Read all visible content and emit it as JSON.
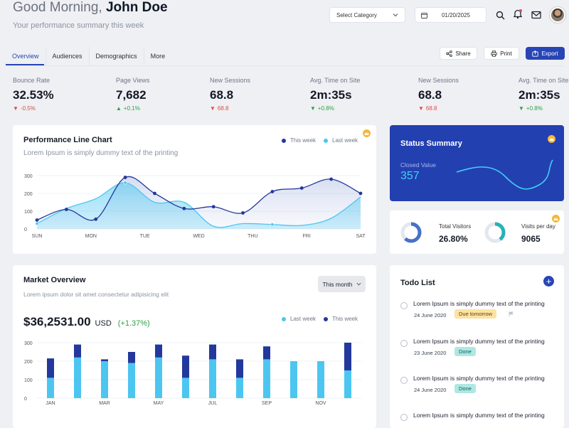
{
  "header": {
    "greeting_prefix": "Good Morning,",
    "user_name": "John Doe",
    "subtitle": "Your performance summary this week",
    "category_select": "Select Category",
    "date": "01/20/2025"
  },
  "tabs": [
    "Overview",
    "Audiences",
    "Demographics",
    "More"
  ],
  "actions": {
    "share": "Share",
    "print": "Print",
    "export": "Export"
  },
  "kpis": [
    {
      "label": "Bounce Rate",
      "value": "32.53%",
      "change": "-0.5%",
      "dir": "down"
    },
    {
      "label": "Page Views",
      "value": "7,682",
      "change": "+0.1%",
      "dir": "up"
    },
    {
      "label": "New Sessions",
      "value": "68.8",
      "change": "68.8",
      "dir": "down"
    },
    {
      "label": "Avg. Time on Site",
      "value": "2m:35s",
      "change": "+0.8%",
      "dir": "up"
    },
    {
      "label": "New Sessions",
      "value": "68.8",
      "change": "68.8",
      "dir": "down"
    },
    {
      "label": "Avg. Time on Site",
      "value": "2m:35s",
      "change": "+0.8%",
      "dir": "up"
    }
  ],
  "performance": {
    "title": "Performance Line Chart",
    "subtitle": "Lorem Ipsum is simply dummy text of the printing",
    "legend_this_week": "This week",
    "legend_last_week": "Last week"
  },
  "status": {
    "title": "Status Summary",
    "closed_label": "Closed Value",
    "closed_value": "357"
  },
  "visitors": {
    "total_label": "Total Visitors",
    "total_value": "26.80%",
    "per_day_label": "Visits per day",
    "per_day_value": "9065"
  },
  "market": {
    "title": "Market Overview",
    "subtitle": "Lorem ipsum dolor sit amet consectetur adipisicing elit",
    "period": "This month",
    "amount": "$36,2531.00",
    "currency": "USD",
    "change": "(+1.37%)",
    "legend_last_week": "Last week",
    "legend_this_week": "This week"
  },
  "todo": {
    "title": "Todo List",
    "items": [
      {
        "text": "Lorem Ipsum is simply dummy text of the printing",
        "date": "24 June 2020",
        "badge": "Due tomorrow"
      },
      {
        "text": "Lorem Ipsum is simply dummy text of the printing",
        "date": "23 June 2020",
        "badge": "Done"
      },
      {
        "text": "Lorem Ipsum is simply dummy text of the printing",
        "date": "24 June 2020",
        "badge": "Done"
      },
      {
        "text": "Lorem Ipsum is simply dummy text of the printing",
        "date": "",
        "badge": ""
      }
    ]
  },
  "colors": {
    "primary": "#2745b5",
    "this_week": "#23389c",
    "last_week": "#4cc6f0",
    "down": "#e24a3b",
    "up": "#2f9e44"
  },
  "chart_data": [
    {
      "type": "area",
      "title": "Performance Line Chart",
      "categories": [
        "SUN",
        "MON",
        "TUE",
        "WED",
        "THU",
        "FRI",
        "SAT"
      ],
      "x": [
        0,
        0.5,
        1,
        1.5,
        2,
        2.5,
        3,
        3.5,
        4,
        4.5,
        5,
        5.5,
        6
      ],
      "ylim": [
        0,
        300
      ],
      "yticks": [
        0,
        100,
        200,
        300
      ],
      "series": [
        {
          "name": "This week",
          "values": [
            50,
            110,
            55,
            290,
            200,
            115,
            125,
            90,
            210,
            230,
            280,
            200
          ]
        },
        {
          "name": "Last week",
          "values": [
            30,
            115,
            170,
            260,
            150,
            150,
            15,
            30,
            25,
            20,
            60,
            180
          ]
        }
      ]
    },
    {
      "type": "bar",
      "title": "Market Overview",
      "categories": [
        "JAN",
        "",
        "MAR",
        "",
        "MAY",
        "",
        "JUL",
        "",
        "SEP",
        "",
        "NOV",
        ""
      ],
      "ylim": [
        0,
        300
      ],
      "yticks": [
        0,
        100,
        200,
        300
      ],
      "series": [
        {
          "name": "Last week",
          "values": [
            110,
            220,
            200,
            190,
            220,
            110,
            210,
            110,
            210,
            200,
            200,
            150
          ]
        },
        {
          "name": "This week",
          "values": [
            105,
            70,
            10,
            60,
            70,
            120,
            80,
            100,
            70,
            0,
            0,
            150
          ]
        }
      ]
    }
  ]
}
